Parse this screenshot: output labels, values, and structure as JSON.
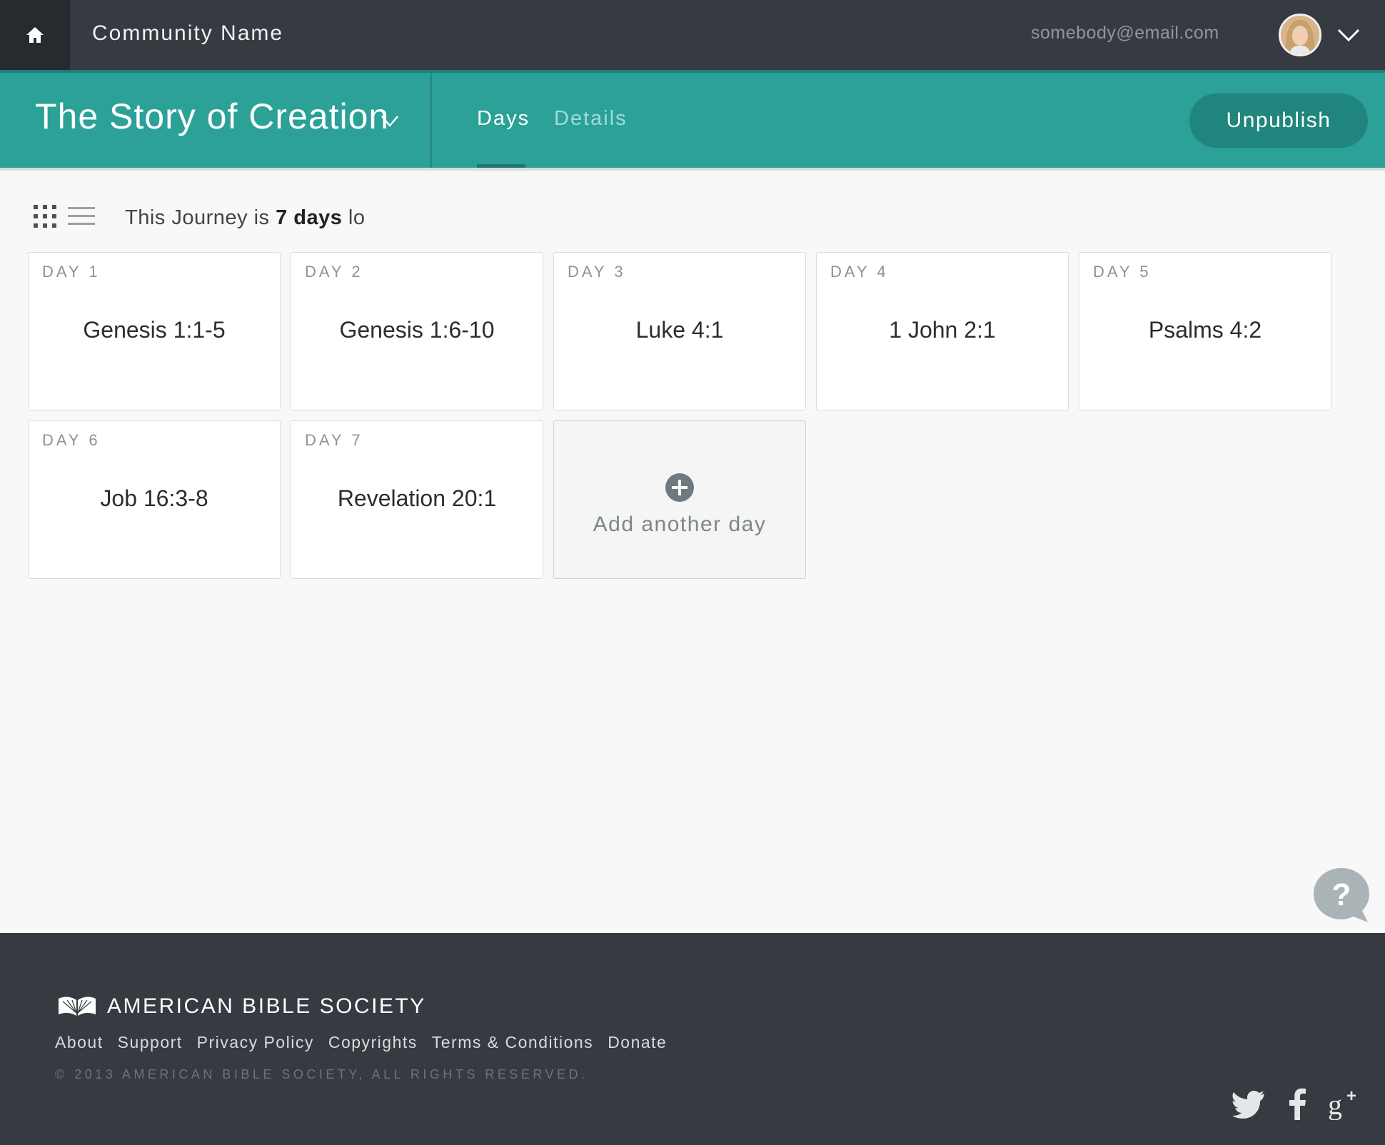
{
  "topbar": {
    "home_icon": "home-icon",
    "community_name": "Community Name",
    "email": "somebody@email.com",
    "account_icon": "chevron-down-icon"
  },
  "journey": {
    "title": "The Story of Creation",
    "tabs": [
      {
        "label": "Days",
        "active": true
      },
      {
        "label": "Details",
        "active": false
      }
    ],
    "unpublish_label": "Unpublish"
  },
  "toolbar": {
    "length_prefix": "This Journey is ",
    "length_value": "7 days",
    "length_suffix": " lo"
  },
  "days": [
    {
      "label": "DAY 1",
      "passage": "Genesis 1:1-5"
    },
    {
      "label": "DAY 2",
      "passage": "Genesis 1:6-10"
    },
    {
      "label": "DAY 3",
      "passage": "Luke 4:1"
    },
    {
      "label": "DAY 4",
      "passage": "1 John 2:1"
    },
    {
      "label": "DAY 5",
      "passage": "Psalms 4:2"
    },
    {
      "label": "DAY 6",
      "passage": "Job 16:3-8"
    },
    {
      "label": "DAY 7",
      "passage": "Revelation 20:1"
    }
  ],
  "add_day_label": "Add another day",
  "footer": {
    "org_name": "AMERICAN BIBLE SOCIETY",
    "links": [
      "About",
      "Support",
      "Privacy Policy",
      "Copyrights",
      "Terms & Conditions",
      "Donate"
    ],
    "copyright": "© 2013 AMERICAN BIBLE SOCIETY, ALL RIGHTS RESERVED.",
    "social_icons": [
      "twitter-icon",
      "facebook-icon",
      "google-plus-icon"
    ]
  },
  "colors": {
    "topbar": "#353b40",
    "accent": "#2ba198",
    "accent_dark": "#1f857d",
    "footer": "#353b40"
  }
}
